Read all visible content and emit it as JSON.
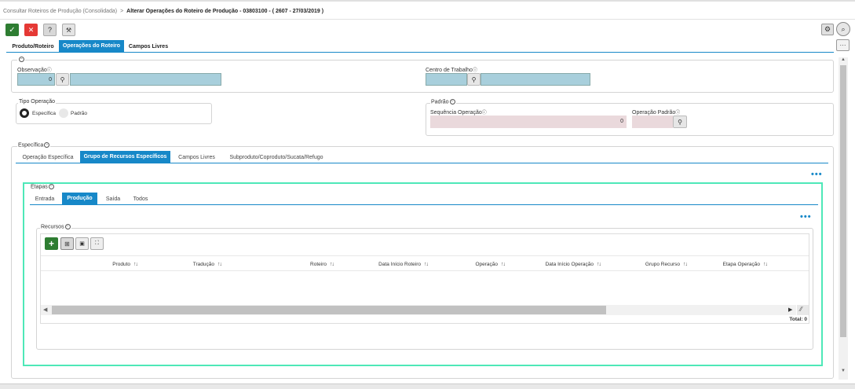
{
  "breadcrumb": {
    "parent": "Consultar Roteiros de Produção (Consolidada)",
    "separator": ">",
    "current": "Alterar Operações do Roteiro de Produção - 03803100 - ( 2607 - 27/03/2019 )"
  },
  "toolbar": {
    "confirm": "✓",
    "cancel": "✕",
    "help": "?",
    "tool": "🔧"
  },
  "topright": {
    "settings": "⚙",
    "search": "⌕",
    "more": "···"
  },
  "main_tabs": [
    "Produto/Roteiro",
    "Operações do Roteiro",
    "Campos Livres"
  ],
  "observacao": {
    "label": "Observação",
    "value": "0"
  },
  "centro": {
    "label": "Centro de Trabalho"
  },
  "tipo_operacao": {
    "legend": "Tipo Operação",
    "options": [
      "Específica",
      "Padrão"
    ],
    "selected": "Específica"
  },
  "padrao": {
    "legend": "Padrão",
    "seq_label": "Sequência Operação",
    "seq_value": "0",
    "op_label": "Operação Padrão"
  },
  "especifica": {
    "legend": "Específica",
    "tabs": [
      "Operação Específica",
      "Grupo de Recursos Específicos",
      "Campos Livres",
      "Subproduto/Coproduto/Sucata/Refugo"
    ]
  },
  "etapas": {
    "legend": "Etapas",
    "tabs": [
      "Entrada",
      "Produção",
      "Saída",
      "Todos"
    ]
  },
  "recursos": {
    "legend": "Recursos",
    "columns": [
      "Produto",
      "Tradução",
      "Roteiro",
      "Data Início Roteiro",
      "Operação",
      "Data Início Operação",
      "Grupo Recurso",
      "Etapa Operação"
    ],
    "total_label": "Total: 0"
  },
  "colors": {
    "accent": "#1788c8",
    "success": "#2e7d32",
    "danger": "#e53935",
    "input_fill": "#a8cfdc",
    "disabled_fill": "#ead9dc",
    "etapas_border": "#4ee8b8"
  }
}
